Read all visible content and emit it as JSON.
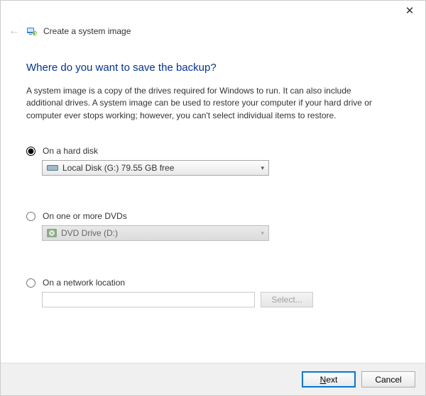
{
  "window": {
    "close_symbol": "✕"
  },
  "header": {
    "back_symbol": "←",
    "wizard_title": "Create a system image"
  },
  "main": {
    "heading": "Where do you want to save the backup?",
    "description": "A system image is a copy of the drives required for Windows to run. It can also include additional drives. A system image can be used to restore your computer if your hard drive or computer ever stops working; however, you can't select individual items to restore."
  },
  "options": {
    "hard_disk": {
      "label": "On a hard disk",
      "selected_value": "Local Disk (G:)  79.55 GB free",
      "checked": true
    },
    "dvd": {
      "label": "On one or more DVDs",
      "selected_value": "DVD Drive (D:)",
      "checked": false
    },
    "network": {
      "label": "On a network location",
      "path_value": "",
      "select_button": "Select...",
      "checked": false
    }
  },
  "footer": {
    "next_prefix": "N",
    "next_rest": "ext",
    "cancel": "Cancel"
  }
}
